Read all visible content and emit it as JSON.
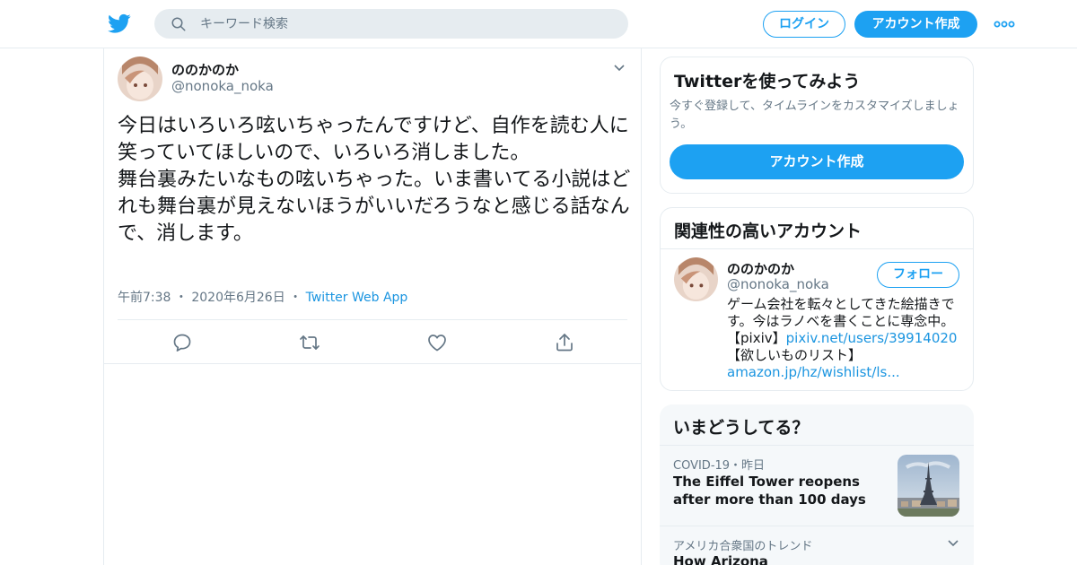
{
  "header": {
    "search_placeholder": "キーワード検索",
    "login_label": "ログイン",
    "signup_label": "アカウント作成"
  },
  "tweet": {
    "display_name": "ののかのか",
    "handle": "@nonoka_noka",
    "text_lines": [
      "今日はいろいろ呟いちゃったんですけど、自作を読む人に笑っていてほしいので、いろいろ消しました。",
      "舞台裏みたいなもの呟いちゃった。いま書いてる小説はどれも舞台裏が見えないほうがいいだろうなと感じる話なんで、消します。"
    ],
    "time": "午前7:38",
    "date": "2020年6月26日",
    "source": "Twitter Web App"
  },
  "signup_card": {
    "title": "Twitterを使ってみよう",
    "subtitle": "今すぐ登録して、タイムラインをカスタマイズしましょう。",
    "button": "アカウント作成"
  },
  "related_card": {
    "title": "関連性の高いアカウント",
    "name": "ののかのか",
    "handle": "@nonoka_noka",
    "follow_label": "フォロー",
    "bio_1": "ゲーム会社を転々としてきた絵描きです。今はラノベを書くことに専念中。【pixiv】",
    "bio_link1": "pixiv.net/users/39914020",
    "bio_2": "【欲しいものリスト】",
    "bio_link2": "amazon.jp/hz/wishlist/ls..."
  },
  "trends_card": {
    "title": "いまどうしてる？",
    "item1_context": "COVID-19・昨日",
    "item1_headline": "The Eiffel Tower reopens after more than 100 days",
    "item2_context": "アメリカ合衆国のトレンド",
    "item2_headline": "How Arizona"
  },
  "colors": {
    "accent": "#1da1f2",
    "link": "#1b95e0",
    "muted": "#657786",
    "border": "#e6ecf0"
  },
  "icons": [
    "twitter-bird-icon",
    "search-icon",
    "more-icon",
    "chevron-down-icon",
    "reply-icon",
    "retweet-icon",
    "like-icon",
    "share-icon"
  ]
}
